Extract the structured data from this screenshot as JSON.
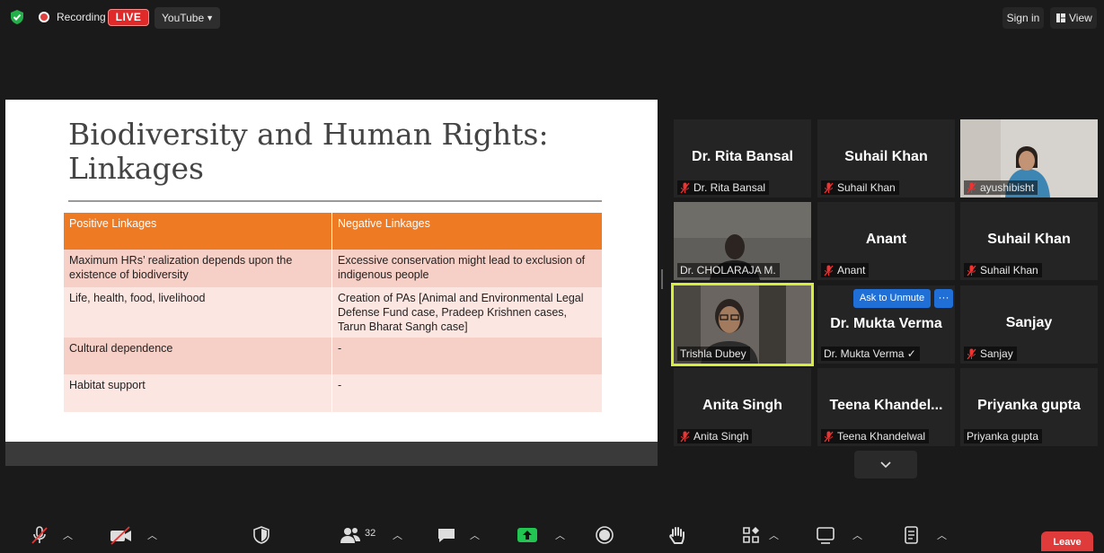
{
  "topbar": {
    "recording_label": "Recording",
    "live_badge": "LIVE",
    "stream_target": "YouTube",
    "sign_in_label": "Sign in",
    "view_label": "View"
  },
  "slide": {
    "title_line1": "Biodiversity and Human Rights:",
    "title_line2": "Linkages",
    "headers": [
      "Positive Linkages",
      "Negative Linkages"
    ],
    "rows": [
      [
        "Maximum HRs’ realization depends upon the existence of biodiversity",
        "Excessive conservation might lead to exclusion of indigenous people"
      ],
      [
        "Life, health, food, livelihood",
        "Creation of PAs [Animal and Environmental Legal Defense Fund case, Pradeep Krishnen cases, Tarun Bharat Sangh case]"
      ],
      [
        "Cultural dependence",
        "-"
      ],
      [
        "Habitat support",
        "-"
      ]
    ]
  },
  "gallery": {
    "tiles": [
      {
        "display": "Dr. Rita Bansal",
        "name": "Dr. Rita Bansal",
        "muted": true
      },
      {
        "display": "Suhail Khan",
        "name": "Suhail Khan",
        "muted": true
      },
      {
        "display": "",
        "name": "ayushibisht",
        "muted": true
      },
      {
        "display": "",
        "name": "Dr. CHOLARAJA M.",
        "muted": false
      },
      {
        "display": "Anant",
        "name": "Anant",
        "muted": true
      },
      {
        "display": "Suhail Khan",
        "name": "Suhail Khan",
        "muted": true
      },
      {
        "display": "",
        "name": "Trishla Dubey",
        "muted": false
      },
      {
        "display": "Dr. Mukta Verma",
        "name": "Dr. Mukta Verma ✓",
        "muted": false
      },
      {
        "display": "Sanjay",
        "name": "Sanjay",
        "muted": true
      },
      {
        "display": "Anita Singh",
        "name": "Anita Singh",
        "muted": true
      },
      {
        "display": "Teena  Khandel...",
        "name": "Teena Khandelwal",
        "muted": true
      },
      {
        "display": "Priyanka gupta",
        "name": "Priyanka gupta",
        "muted": false
      }
    ],
    "ask_to_unmute": "Ask to Unmute",
    "more_options": "···"
  },
  "toolbar": {
    "participants_count": "32",
    "leave_label": "Leave"
  },
  "colors": {
    "background": "#1a1a1a",
    "live_red": "#e02a2a",
    "active_speaker": "#d7ef3a",
    "slide_header": "#ee7a24",
    "ask_button": "#1f6fd6",
    "leave_red": "#e03b3b",
    "share_green": "#23c552"
  },
  "icons": [
    "shield-icon",
    "record-icon",
    "grid-icon",
    "mic-off-icon",
    "video-off-icon",
    "security-icon",
    "participants-icon",
    "chat-icon",
    "share-screen-icon",
    "record-button-icon",
    "raise-hand-icon",
    "apps-icon",
    "whiteboard-icon",
    "notes-icon",
    "chevron-down-icon"
  ]
}
